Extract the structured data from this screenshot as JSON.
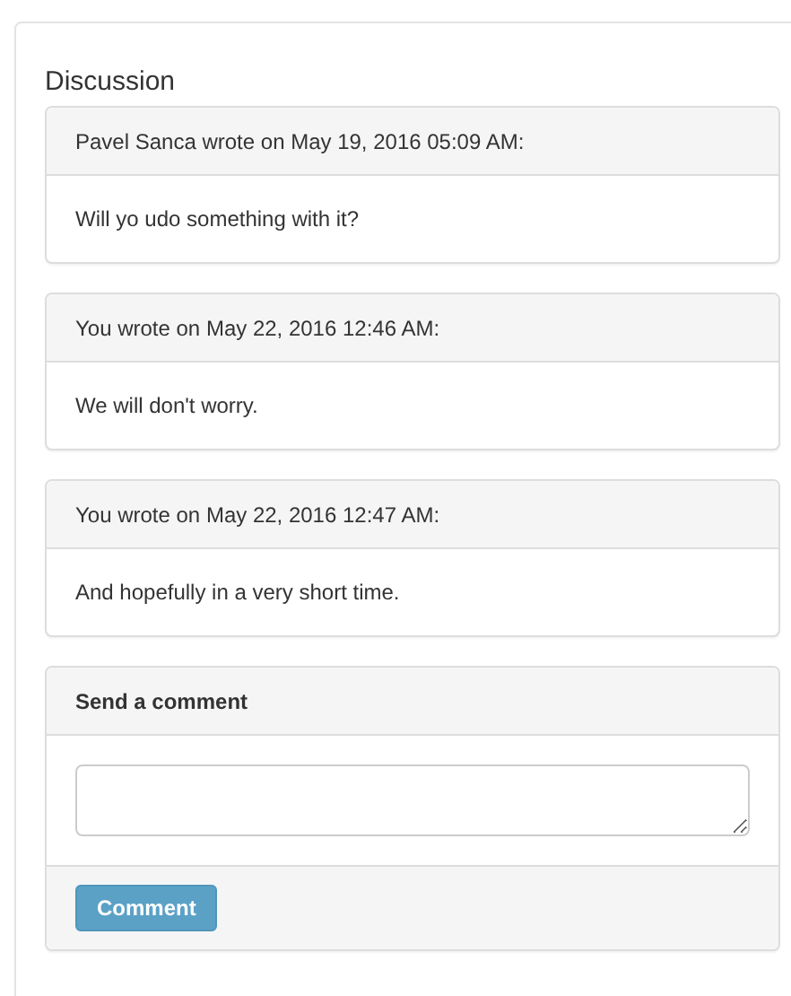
{
  "title": "Discussion",
  "comments": [
    {
      "header": "Pavel Sanca wrote on May 19, 2016 05:09 AM:",
      "body": "Will yo udo something with it?"
    },
    {
      "header": "You wrote on May 22, 2016 12:46 AM:",
      "body": "We will don't worry."
    },
    {
      "header": "You wrote on May 22, 2016 12:47 AM:",
      "body": "And hopefully in a very short time."
    }
  ],
  "form": {
    "title": "Send a comment",
    "button": "Comment"
  }
}
